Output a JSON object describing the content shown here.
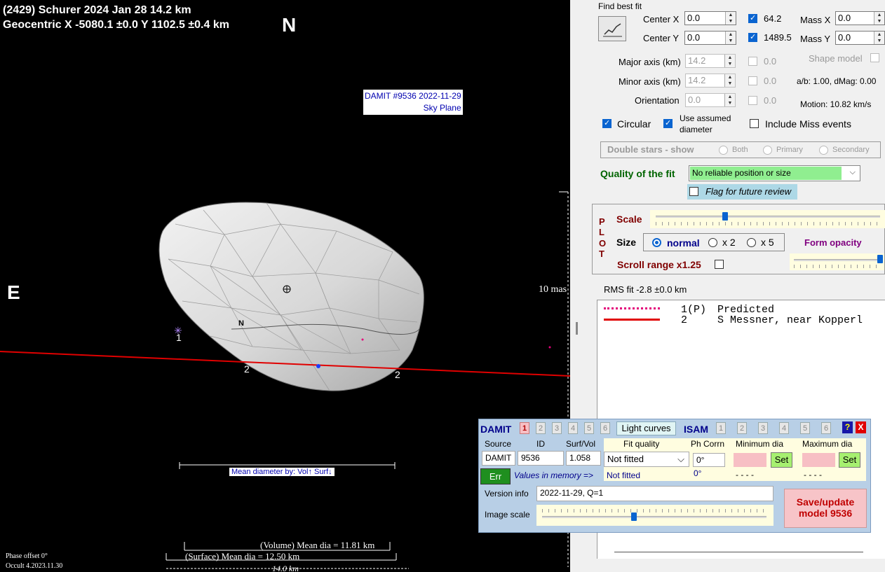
{
  "plot": {
    "title_line1": "(2429) Schurer  2024 Jan 28   14.2 km",
    "title_line2": "Geocentric  X  -5080.1 ±0.0  Y 1102.5 ±0.4 km",
    "north_label": "N",
    "east_label": "E",
    "damit_label_line1": "DAMIT #9536 2022-11-29",
    "damit_label_line2": "Sky Plane",
    "scale_label": "10 mas",
    "body_north_label": "N",
    "chord_label_1": "1",
    "chord_label_2a": "2",
    "chord_label_2b": "2",
    "mean_dia_by": "Mean diameter by: Vol↑ Surf↓",
    "volume_dia": "(Volume) Mean dia = 11.81 km",
    "surface_dia": "(Surface) Mean dia = 12.50 km",
    "width_km": "14.0 km",
    "phase_offset": "Phase offset 0°",
    "version": "Occult 4.2023.11.30"
  },
  "fit": {
    "find_best_fit": "Find best fit",
    "center_x_label": "Center X",
    "center_x_value": "0.0",
    "center_x_fit": "64.2",
    "center_y_label": "Center Y",
    "center_y_value": "0.0",
    "center_y_fit": "1489.5",
    "mass_x_label": "Mass X",
    "mass_x_value": "0.0",
    "mass_y_label": "Mass Y",
    "mass_y_value": "0.0",
    "major_axis_label": "Major axis (km)",
    "major_axis_value": "14.2",
    "major_axis_fit": "0.0",
    "minor_axis_label": "Minor axis (km)",
    "minor_axis_value": "14.2",
    "minor_axis_fit": "0.0",
    "orientation_label": "Orientation",
    "orientation_value": "0.0",
    "orientation_fit": "0.0",
    "shape_model": "Shape model",
    "ab_dmag": "a/b: 1.00, dMag: 0.00",
    "motion": "Motion: 10.82 km/s",
    "circular": "Circular",
    "use_assumed_1": "Use assumed",
    "use_assumed_2": "diameter",
    "include_miss": "Include Miss events",
    "double_stars": "Double stars - show",
    "ds_both": "Both",
    "ds_primary": "Primary",
    "ds_secondary": "Secondary",
    "quality_label": "Quality of the fit",
    "quality_value": "No reliable position or size",
    "flag_review": "Flag for future review"
  },
  "plot_panel": {
    "plot_letters": [
      "P",
      "L",
      "O",
      "T"
    ],
    "scale": "Scale",
    "size": "Size",
    "size_normal": "normal",
    "size_x2": "x 2",
    "size_x5": "x 5",
    "form_opacity": "Form opacity",
    "scroll_range": "Scroll range x1.25",
    "scale_fraction": 0.31,
    "opacity_fraction": 0.98
  },
  "rms": "RMS fit -2.8 ±0.0 km",
  "legend": [
    {
      "num": "1(P)",
      "text": "Predicted",
      "color": "#e4007a"
    },
    {
      "num": "2",
      "text": "S Messner, near Kopperl",
      "color": "#e00000"
    }
  ],
  "damit": {
    "title": "DAMIT",
    "tabs": [
      "1",
      "2",
      "3",
      "4",
      "5",
      "6"
    ],
    "light_curves": "Light curves",
    "isam": "ISAM",
    "isam_tabs": [
      "1",
      "2",
      "3",
      "4",
      "5",
      "6"
    ],
    "help": "?",
    "close": "X",
    "source_label": "Source",
    "id_label": "ID",
    "surfvol_label": "Surf/Vol",
    "source_value": "DAMIT",
    "id_value": "9536",
    "surfvol_value": "1.058",
    "fit_quality_label": "Fit quality",
    "ph_corrn_label": "Ph Corrn",
    "min_dia_label": "Minimum dia",
    "max_dia_label": "Maximum dia",
    "fit_quality_value": "Not fitted",
    "ph_corrn_value": "0°",
    "set": "Set",
    "err": "Err",
    "values_in_memory": "Values in memory =>",
    "fit_quality_mem": "Not fitted",
    "ph_corrn_mem": "0°",
    "min_dia_mem": "- - - -",
    "max_dia_mem": "- - - -",
    "version_label": "Version info",
    "version_value": "2022-11-29, Q=1",
    "image_scale_label": "Image scale",
    "image_scale_fraction": 0.41,
    "save_line1": "Save/update",
    "save_line2": "model 9536"
  }
}
